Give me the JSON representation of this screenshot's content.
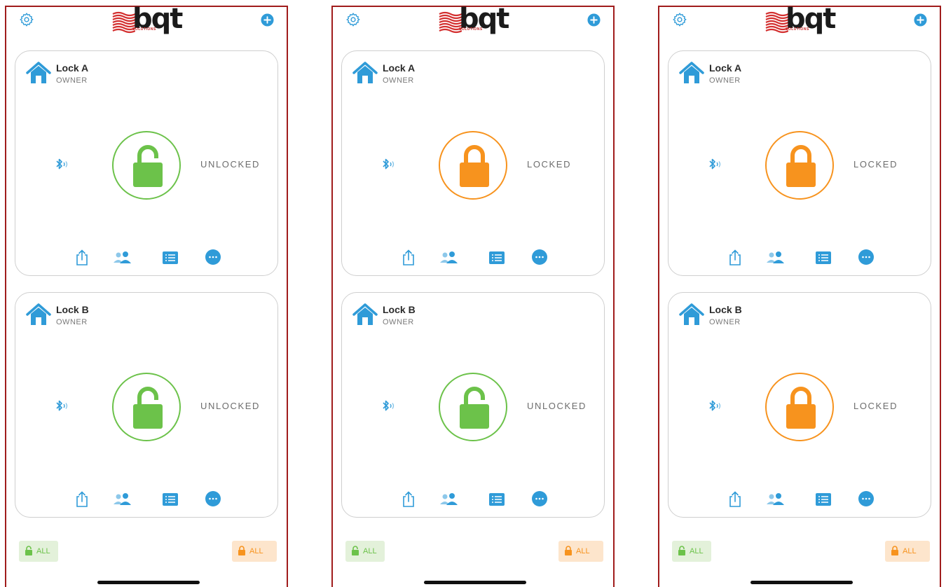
{
  "colors": {
    "frame_border": "#a01c1c",
    "accent_blue": "#2f9bd8",
    "unlocked_green": "#6cc24a",
    "locked_orange": "#f7931e",
    "all_unlock_bg": "#e3f1da",
    "all_lock_bg": "#fde5cc"
  },
  "icons": {
    "settings": "gear-icon",
    "add": "plus-circle-icon",
    "home": "house-icon",
    "bluetooth": "bluetooth-signal-icon",
    "share": "share-icon",
    "users": "users-icon",
    "log": "list-icon",
    "more": "more-icon"
  },
  "logo": {
    "text": "bqt",
    "subtext": "SOLUTIONS"
  },
  "screens": [
    {
      "locks": [
        {
          "name": "Lock A",
          "role": "OWNER",
          "status": "UNLOCKED",
          "state": "unlocked"
        },
        {
          "name": "Lock B",
          "role": "OWNER",
          "status": "UNLOCKED",
          "state": "unlocked"
        }
      ],
      "unlock_all_label": "ALL",
      "lock_all_label": "ALL"
    },
    {
      "locks": [
        {
          "name": "Lock A",
          "role": "OWNER",
          "status": "LOCKED",
          "state": "locked"
        },
        {
          "name": "Lock B",
          "role": "OWNER",
          "status": "UNLOCKED",
          "state": "unlocked"
        }
      ],
      "unlock_all_label": "ALL",
      "lock_all_label": "ALL"
    },
    {
      "locks": [
        {
          "name": "Lock A",
          "role": "OWNER",
          "status": "LOCKED",
          "state": "locked"
        },
        {
          "name": "Lock B",
          "role": "OWNER",
          "status": "LOCKED",
          "state": "locked"
        }
      ],
      "unlock_all_label": "ALL",
      "lock_all_label": "ALL"
    }
  ]
}
